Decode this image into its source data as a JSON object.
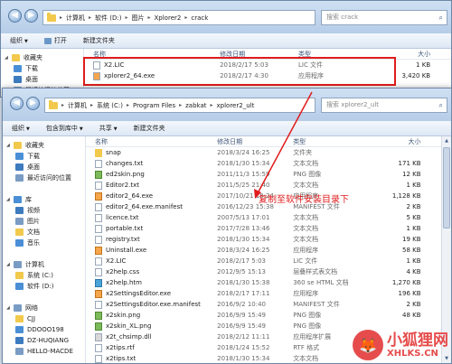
{
  "win1": {
    "address": [
      "计算机",
      "软件 (D:)",
      "图片",
      "Xplorer2",
      "crack"
    ],
    "search_placeholder": "搜索 crack",
    "toolbar": [
      "组织",
      "打开",
      "新建文件夹"
    ],
    "sidebar": [
      "收藏夹",
      "下载",
      "桌面",
      "最近访问的位置"
    ],
    "columns": [
      "名称",
      "修改日期",
      "类型",
      "大小"
    ],
    "files": [
      {
        "name": "X2.LIC",
        "date": "2018/2/17 5:03",
        "type": "LIC 文件",
        "size": "1 KB"
      },
      {
        "name": "xplorer2_64.exe",
        "date": "2018/2/17 4:30",
        "type": "应用程序",
        "size": "3,420 KB"
      }
    ]
  },
  "win2": {
    "address": [
      "计算机",
      "系统 (C:)",
      "Program Files",
      "zabkat",
      "xplorer2_ult"
    ],
    "search_placeholder": "搜索 xplorer2_ult",
    "toolbar": [
      "组织",
      "包含到库中",
      "共享",
      "新建文件夹"
    ],
    "sidebar": [
      {
        "label": "收藏夹",
        "level": 0
      },
      {
        "label": "下载",
        "level": 1
      },
      {
        "label": "桌面",
        "level": 1
      },
      {
        "label": "最近访问的位置",
        "level": 1
      },
      {
        "label": "",
        "level": -1
      },
      {
        "label": "库",
        "level": 0
      },
      {
        "label": "视频",
        "level": 1
      },
      {
        "label": "图片",
        "level": 1
      },
      {
        "label": "文档",
        "level": 1
      },
      {
        "label": "音乐",
        "level": 1
      },
      {
        "label": "",
        "level": -1
      },
      {
        "label": "计算机",
        "level": 0
      },
      {
        "label": "系统 (C:)",
        "level": 1
      },
      {
        "label": "软件 (D:)",
        "level": 1
      },
      {
        "label": "",
        "level": -1
      },
      {
        "label": "网络",
        "level": 0
      },
      {
        "label": "CJJ",
        "level": 1
      },
      {
        "label": "DDOOO198",
        "level": 1
      },
      {
        "label": "DZ-HUQIANG",
        "level": 1
      },
      {
        "label": "HELLO-MACDE",
        "level": 1
      }
    ],
    "columns": [
      "名称",
      "修改日期",
      "类型",
      "大小"
    ],
    "files": [
      {
        "name": "snap",
        "date": "2018/3/24 16:25",
        "type": "文件夹",
        "size": "",
        "kind": "folder"
      },
      {
        "name": "changes.txt",
        "date": "2018/1/30 15:34",
        "type": "文本文档",
        "size": "171 KB",
        "kind": "txt"
      },
      {
        "name": "ed2skin.png",
        "date": "2011/11/3 15:59",
        "type": "PNG 图像",
        "size": "12 KB",
        "kind": "img"
      },
      {
        "name": "Editor2.txt",
        "date": "2011/5/25 21:40",
        "type": "文本文档",
        "size": "1 KB",
        "kind": "txt"
      },
      {
        "name": "editor2_64.exe",
        "date": "2017/10/21 18:24",
        "type": "应用程序",
        "size": "1,128 KB",
        "kind": "exe"
      },
      {
        "name": "editor2_64.exe.manifest",
        "date": "2016/12/23 15:38",
        "type": "MANIFEST 文件",
        "size": "2 KB",
        "kind": "txt"
      },
      {
        "name": "licence.txt",
        "date": "2007/5/13 17:01",
        "type": "文本文档",
        "size": "5 KB",
        "kind": "txt"
      },
      {
        "name": "portable.txt",
        "date": "2017/7/28 13:46",
        "type": "文本文档",
        "size": "1 KB",
        "kind": "txt"
      },
      {
        "name": "registry.txt",
        "date": "2018/1/30 15:34",
        "type": "文本文档",
        "size": "19 KB",
        "kind": "txt"
      },
      {
        "name": "Uninstall.exe",
        "date": "2018/3/24 16:25",
        "type": "应用程序",
        "size": "58 KB",
        "kind": "exe"
      },
      {
        "name": "X2.LIC",
        "date": "2018/2/17 5:03",
        "type": "LIC 文件",
        "size": "1 KB",
        "kind": "txt"
      },
      {
        "name": "x2help.css",
        "date": "2012/9/5 15:13",
        "type": "层叠样式表文档",
        "size": "4 KB",
        "kind": "txt"
      },
      {
        "name": "x2help.htm",
        "date": "2018/1/30 15:38",
        "type": "360 se HTML 文档",
        "size": "1,270 KB",
        "kind": "htm"
      },
      {
        "name": "x2SettingsEditor.exe",
        "date": "2018/2/17 17:11",
        "type": "应用程序",
        "size": "196 KB",
        "kind": "exe"
      },
      {
        "name": "x2SettingsEditor.exe.manifest",
        "date": "2016/9/2 10:40",
        "type": "MANIFEST 文件",
        "size": "2 KB",
        "kind": "txt"
      },
      {
        "name": "x2skin.png",
        "date": "2016/9/9 15:49",
        "type": "PNG 图像",
        "size": "48 KB",
        "kind": "img"
      },
      {
        "name": "x2skin_XL.png",
        "date": "2016/9/9 15:49",
        "type": "PNG 图像",
        "size": "",
        "kind": "img"
      },
      {
        "name": "x2t_chsimp.dll",
        "date": "2018/2/12 11:11",
        "type": "应用程序扩展",
        "size": "",
        "kind": "dll"
      },
      {
        "name": "x2tips.rtf",
        "date": "2018/1/24 15:52",
        "type": "RTF 格式",
        "size": "",
        "kind": "txt"
      },
      {
        "name": "x2tips.txt",
        "date": "2018/1/30 15:34",
        "type": "文本文档",
        "size": "",
        "kind": "txt"
      }
    ]
  },
  "annotation": "复制至软件安装目录下",
  "watermark": {
    "cn": "小狐狸网",
    "url": "XHLKS.CN"
  },
  "colors": {
    "highlight": "#e01c1c",
    "folder": "#f2c94c"
  }
}
